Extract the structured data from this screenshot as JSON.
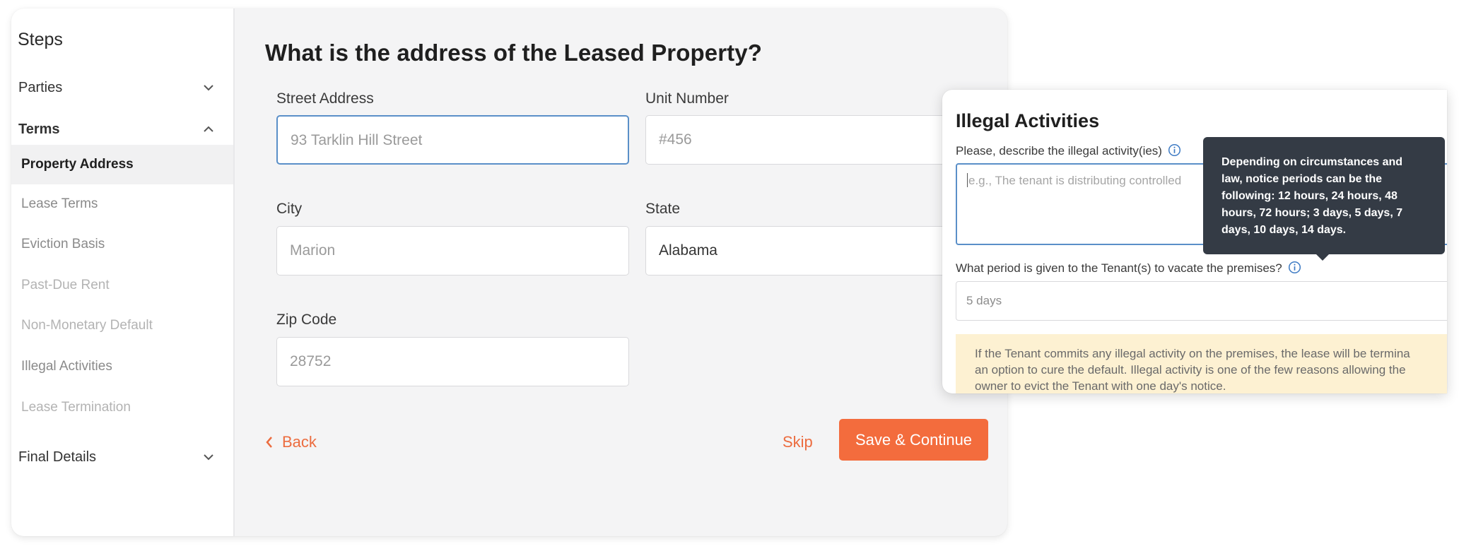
{
  "sidebar": {
    "title": "Steps",
    "sections": [
      {
        "label": "Parties",
        "expanded": false,
        "icon": "chevron-down-icon"
      },
      {
        "label": "Terms",
        "expanded": true,
        "icon": "chevron-up-icon"
      },
      {
        "label": "Final Details",
        "expanded": false,
        "icon": "chevron-down-icon"
      }
    ],
    "terms_items": [
      {
        "label": "Property Address",
        "state": "active"
      },
      {
        "label": "Lease Terms",
        "state": "enabled"
      },
      {
        "label": "Eviction Basis",
        "state": "enabled"
      },
      {
        "label": "Past-Due Rent",
        "state": "disabled"
      },
      {
        "label": "Non-Monetary Default",
        "state": "disabled"
      },
      {
        "label": "Illegal Activities",
        "state": "enabled"
      },
      {
        "label": "Lease Termination",
        "state": "disabled"
      }
    ]
  },
  "main": {
    "question": "What is the address of the Leased Property?",
    "fields": {
      "street": {
        "label": "Street Address",
        "placeholder": "93 Tarklin Hill Street"
      },
      "unit": {
        "label": "Unit Number",
        "placeholder": "#456"
      },
      "city": {
        "label": "City",
        "placeholder": "Marion"
      },
      "state": {
        "label": "State",
        "value": "Alabama"
      },
      "zip": {
        "label": "Zip Code",
        "placeholder": "28752"
      }
    },
    "back_label": "Back",
    "skip_label": "Skip",
    "save_label": "Save & Continue"
  },
  "modal": {
    "title": "Illegal Activities",
    "describe_label": "Please, describe the illegal activity(ies)",
    "describe_placeholder": "e.g., The tenant is distributing controlled",
    "period_label": "What period is given to the Tenant(s) to vacate the premises?",
    "period_value": "5 days",
    "note_lines": [
      "If the Tenant commits any illegal activity on the premises, the lease will be termina",
      "an option to cure the default. Illegal activity is one of the few reasons allowing the",
      "owner to evict the Tenant with one day's notice."
    ],
    "tooltip_lines": [
      "Depending on circumstances and",
      "law, notice periods can be the",
      "following: 12 hours, 24 hours, 48",
      "hours, 72 hours; 3 days, 5 days, 7",
      "days, 10 days, 14 days."
    ]
  },
  "colors": {
    "accent": "#f36c3d",
    "focus_border": "#5a8fc8",
    "tooltip_bg": "#343b45",
    "note_bg": "#fdf1d2"
  }
}
